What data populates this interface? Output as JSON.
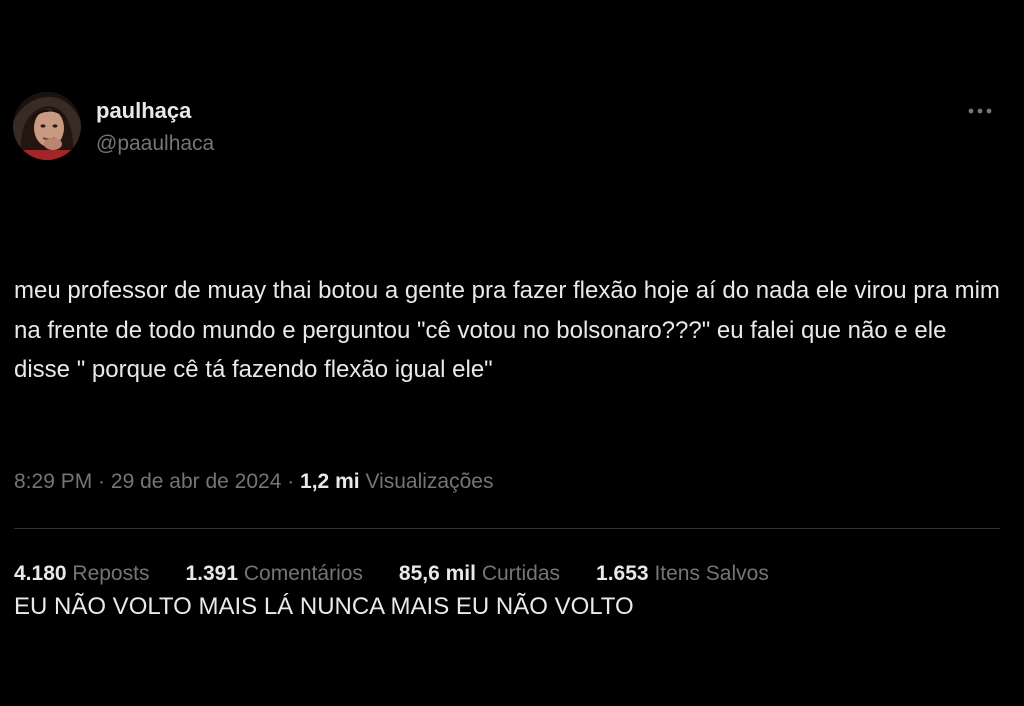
{
  "user": {
    "display_name": "paulhaça",
    "handle": "@paaulhaca"
  },
  "more_icon": "more-horizontal-icon",
  "tweet": {
    "paragraph_1": "meu professor de muay thai botou a gente pra fazer flexão hoje aí do nada ele virou pra mim na frente de todo mundo e perguntou \"cê votou no bolsonaro???\" eu falei que não e ele disse \" porque cê tá fazendo flexão igual ele\"",
    "paragraph_2": "EU NÃO VOLTO MAIS LÁ NUNCA MAIS EU NÃO VOLTO"
  },
  "meta": {
    "time": "8:29 PM",
    "separator_1": " · ",
    "date": "29 de abr de 2024",
    "separator_2": " · ",
    "views_count": "1,2 mi",
    "views_label": "Visualizações"
  },
  "stats": {
    "reposts": {
      "count": "4.180",
      "label": "Reposts"
    },
    "comments": {
      "count": "1.391",
      "label": "Comentários"
    },
    "likes": {
      "count": "85,6 mil",
      "label": "Curtidas"
    },
    "saves": {
      "count": "1.653",
      "label": "Itens Salvos"
    }
  },
  "colors": {
    "background": "#000000",
    "primary_text": "#e7e9ea",
    "secondary_text": "#71767b",
    "divider": "#2f3336"
  }
}
